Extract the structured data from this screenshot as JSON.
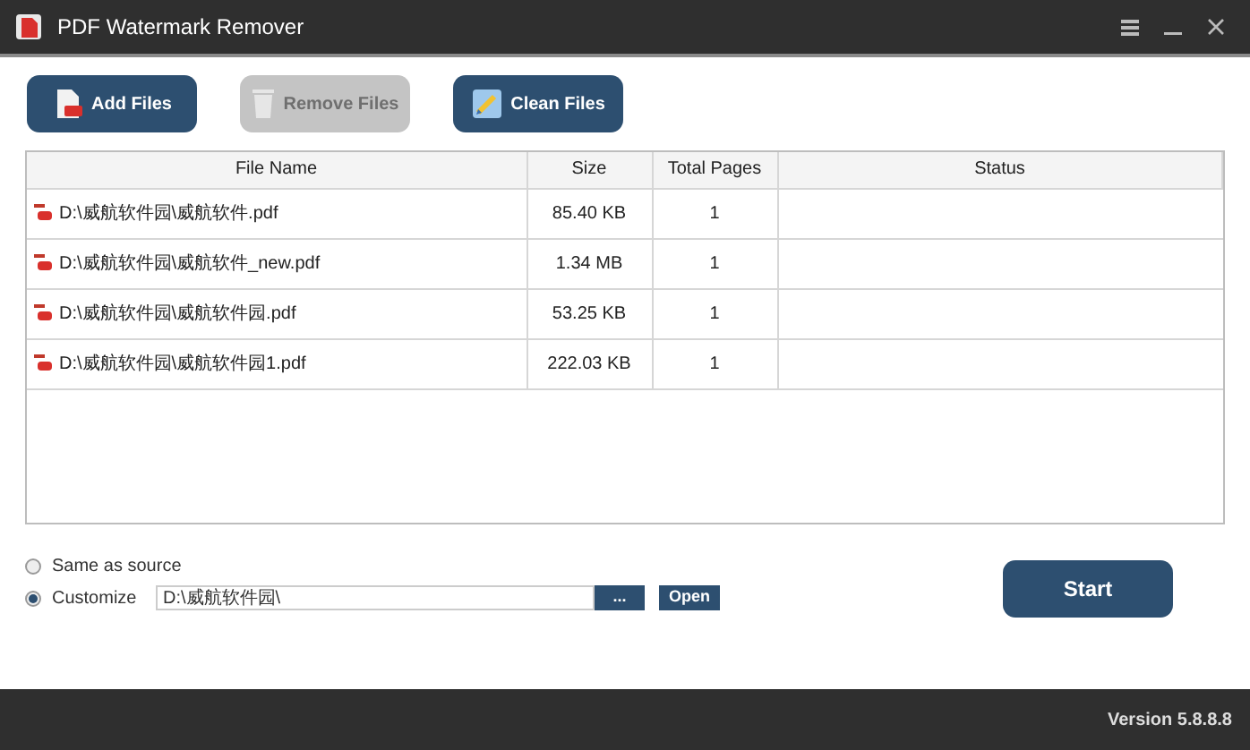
{
  "window": {
    "title": "PDF Watermark Remover"
  },
  "toolbar": [
    {
      "label": "Add Files",
      "kind": "add",
      "disabled": false
    },
    {
      "label": "Remove Files",
      "kind": "remove",
      "disabled": true
    },
    {
      "label": "Clean Files",
      "kind": "clean",
      "disabled": false
    }
  ],
  "table": {
    "columns": [
      "File Name",
      "Size",
      "Total Pages",
      "Status"
    ],
    "rows": [
      {
        "file_name": "D:\\威航软件园\\威航软件.pdf",
        "size": "85.40 KB",
        "total_pages": "1"
      },
      {
        "file_name": "D:\\威航软件园\\威航软件_new.pdf",
        "size": "1.34 MB",
        "total_pages": "1"
      },
      {
        "file_name": "D:\\威航软件园\\威航软件园.pdf",
        "size": "53.25 KB",
        "total_pages": "1"
      },
      {
        "file_name": "D:\\威航软件园\\威航软件园1.pdf",
        "size": "222.03 KB",
        "total_pages": "1"
      }
    ]
  },
  "output": {
    "options": [
      {
        "label": "Same as source",
        "selected": false
      },
      {
        "label": "Customize",
        "selected": true
      }
    ],
    "path": "D:\\威航软件园\\",
    "browse_label": "...",
    "open_label": "Open"
  },
  "start_label": "Start",
  "status_bar": {
    "version": "Version 5.8.8.8"
  }
}
